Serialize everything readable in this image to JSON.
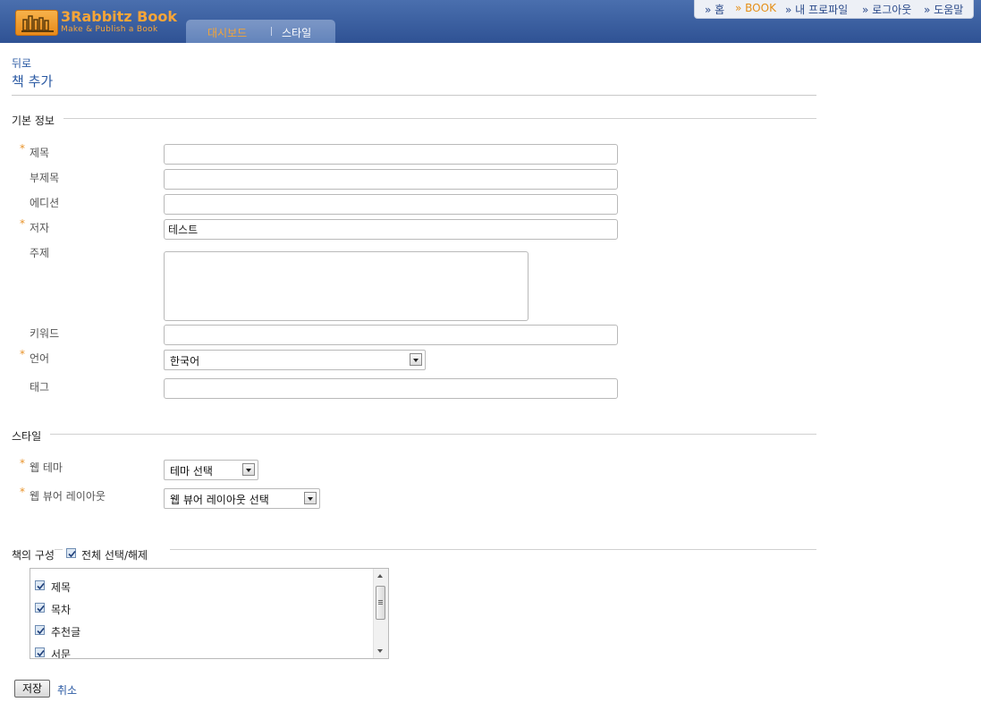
{
  "header": {
    "brand": "3Rabbitz Book",
    "tagline": "Make & Publish a Book",
    "tabs": [
      {
        "label": "대시보드",
        "active": true
      },
      {
        "label": "스타일",
        "active": false
      }
    ],
    "nav": [
      {
        "label": "» 홈"
      },
      {
        "label": "» BOOK",
        "current": true
      },
      {
        "label": "» 내 프로파일"
      },
      {
        "label": "» 로그아웃"
      },
      {
        "label": "» 도움말"
      }
    ],
    "accent": "#f4a436",
    "bar_color": "#34589a"
  },
  "page": {
    "back": "뒤로",
    "title": "책 추가"
  },
  "basic": {
    "legend": "기본 정보",
    "required_mark": "*",
    "title_label": "제목",
    "title_value": "",
    "subtitle_label": "부제목",
    "subtitle_value": "",
    "edition_label": "에디션",
    "edition_value": "",
    "author_label": "저자",
    "author_value": "테스트",
    "subject_label": "주제",
    "subject_value": "",
    "keyword_label": "키워드",
    "keyword_value": "",
    "language_label": "언어",
    "language_value": "한국어",
    "tag_label": "태그",
    "tag_value": ""
  },
  "style": {
    "legend": "스타일",
    "web_theme_label": "웹 테마",
    "web_theme_value": "테마 선택",
    "viewer_layout_label": "웹 뷰어 레이아웃",
    "viewer_layout_value": "웹 뷰어 레이아웃 선택"
  },
  "composition": {
    "legend": "책의 구성",
    "select_all_label": "전체 선택/해제",
    "select_all_checked": true,
    "items": [
      {
        "label": "제목",
        "checked": true
      },
      {
        "label": "목차",
        "checked": true
      },
      {
        "label": "추천글",
        "checked": true
      },
      {
        "label": "서문",
        "checked": true
      }
    ]
  },
  "actions": {
    "save": "저장",
    "cancel": "취소"
  }
}
